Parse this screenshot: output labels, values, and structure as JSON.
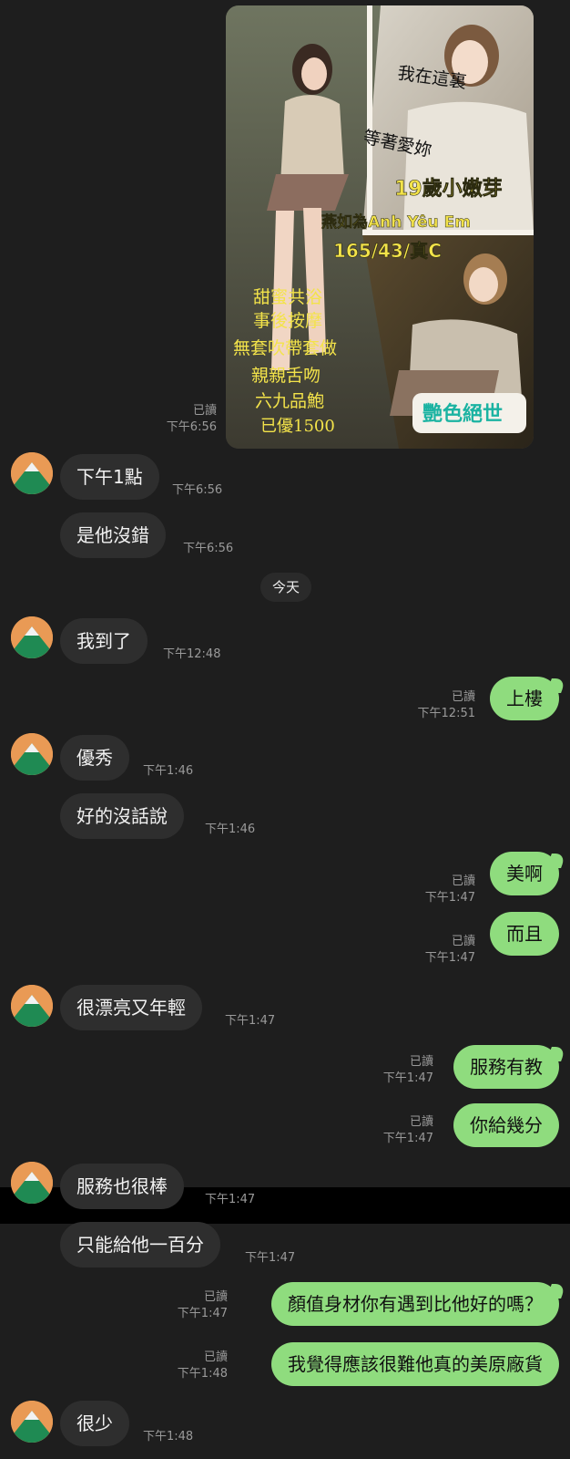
{
  "image_post": {
    "caption_lines": [
      "我在這裏",
      "等著愛妳",
      "19歲小嫩芽",
      "燕如為Anh Yêu Em",
      "165/43/真C",
      "甜蜜共浴",
      "事後按摩",
      "無套吹帶套做",
      "親親舌吻",
      "六九品鮑",
      "已優1500",
      "艷色絕世"
    ],
    "read": "已讀",
    "time": "下午6:56"
  },
  "date_separator": "今天",
  "messages": [
    {
      "side": "in",
      "text": "下午1點",
      "time": "下午6:56"
    },
    {
      "side": "in",
      "text": "是他沒錯",
      "time": "下午6:56"
    },
    {
      "side": "in",
      "text": "我到了",
      "time": "下午12:48"
    },
    {
      "side": "out",
      "text": "上樓",
      "read": "已讀",
      "time": "下午12:51"
    },
    {
      "side": "in",
      "text": "優秀",
      "time": "下午1:46"
    },
    {
      "side": "in",
      "text": "好的沒話說",
      "time": "下午1:46"
    },
    {
      "side": "out",
      "text": "美啊",
      "read": "已讀",
      "time": "下午1:47"
    },
    {
      "side": "out",
      "text": "而且",
      "read": "已讀",
      "time": "下午1:47"
    },
    {
      "side": "in",
      "text": "很漂亮又年輕",
      "time": "下午1:47"
    },
    {
      "side": "out",
      "text": "服務有教",
      "read": "已讀",
      "time": "下午1:47"
    },
    {
      "side": "out",
      "text": "你給幾分",
      "read": "已讀",
      "time": "下午1:47"
    },
    {
      "side": "in",
      "text": "服務也很棒",
      "time": "下午1:47"
    },
    {
      "side": "in",
      "text": "只能給他一百分",
      "time": "下午1:47"
    },
    {
      "side": "out",
      "text": "顏值身材你有遇到比他好的嗎？",
      "read": "已讀",
      "time": "下午1:47"
    },
    {
      "side": "out",
      "text": "我覺得應該很難他真的美原廠貨",
      "read": "已讀",
      "time": "下午1:48"
    },
    {
      "side": "in",
      "text": "很少",
      "time": "下午1:48"
    }
  ],
  "colors": {
    "background": "#1e1e1e",
    "incoming_bubble": "#2e2e2e",
    "outgoing_bubble": "#8fdc7e",
    "avatar": "#e99a55"
  }
}
